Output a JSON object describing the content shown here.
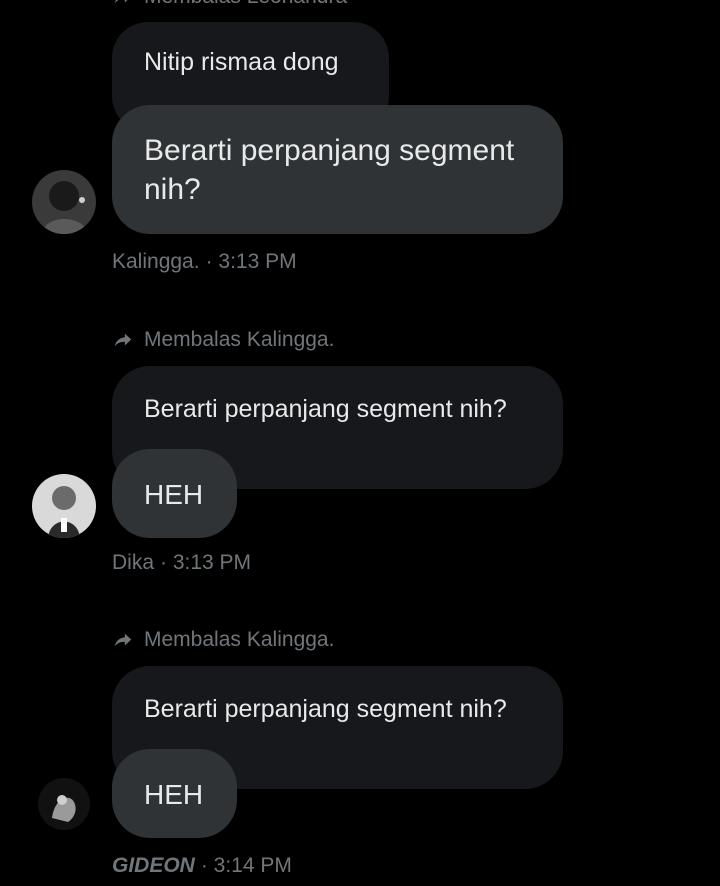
{
  "top_reply": {
    "label": "Membalas Leonandra"
  },
  "group1": {
    "quoted_text": "Nitip rismaa dong",
    "message_line1": "Berarti perpanjang segment",
    "message_line2": "nih?",
    "author": "Kalingga.",
    "time": "· 3:13 PM"
  },
  "group2": {
    "reply_prefix": "Membalas",
    "reply_to": "Kalingga.",
    "quoted_text": "Berarti perpanjang segment nih?",
    "message": "HEH",
    "author": "Dika",
    "time": "· 3:13 PM"
  },
  "group3": {
    "reply_prefix": "Membalas",
    "reply_to": "Kalingga.",
    "quoted_text": "Berarti perpanjang segment nih?",
    "message": "HEH",
    "author": "GIDEON",
    "time": "· 3:14 PM"
  },
  "colors": {
    "background": "#000000",
    "bubble_main": "#2f3336",
    "bubble_quoted": "#16181c",
    "text": "#e7e9ea",
    "muted": "#71767b"
  }
}
